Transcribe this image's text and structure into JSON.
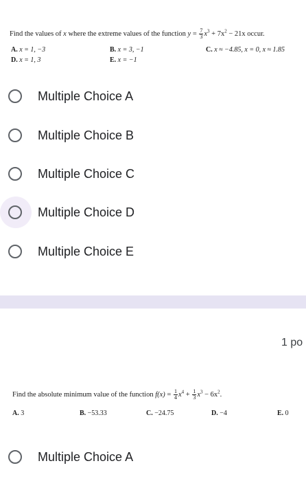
{
  "question1": {
    "prefix": "Find the values of ",
    "var_x": "x",
    "middle": " where the extreme values of the function ",
    "func_y": "y",
    "eq": " = ",
    "frac_num": "7",
    "frac_den": "3",
    "term1": "x",
    "term1_exp": "3",
    "term2": " + 7x",
    "term2_exp": "2",
    "term3": " − 21x",
    "suffix": " occur.",
    "answers": [
      {
        "letter": "A.",
        "text": "x = 1,  −3"
      },
      {
        "letter": "B.",
        "text": "x = 3,  −1"
      },
      {
        "letter": "C.",
        "text": "x ≈ −4.85, x = 0, x ≈ 1.85"
      },
      {
        "letter": "D.",
        "text": "x = 1, 3"
      },
      {
        "letter": "E.",
        "text": "x = −1"
      }
    ],
    "choices": [
      "Multiple Choice A",
      "Multiple Choice B",
      "Multiple Choice C",
      "Multiple Choice D",
      "Multiple Choice E"
    ]
  },
  "question2": {
    "points": "1 po",
    "prefix": "Find the absolute minimum value of the function ",
    "func": "f(x)",
    "eq": " = ",
    "frac1_num": "1",
    "frac1_den": "4",
    "term1": "x",
    "term1_exp": "4",
    "plus": " + ",
    "frac2_num": "1",
    "frac2_den": "3",
    "term2": "x",
    "term2_exp": "3",
    "term3": " − 6x",
    "term3_exp": "2",
    "suffix": ".",
    "answers": [
      {
        "letter": "A.",
        "text": "3"
      },
      {
        "letter": "B.",
        "text": "−53.33"
      },
      {
        "letter": "C.",
        "text": "−24.75"
      },
      {
        "letter": "D.",
        "text": "−4"
      },
      {
        "letter": "E.",
        "text": "0"
      }
    ],
    "choices": [
      "Multiple Choice A"
    ]
  }
}
